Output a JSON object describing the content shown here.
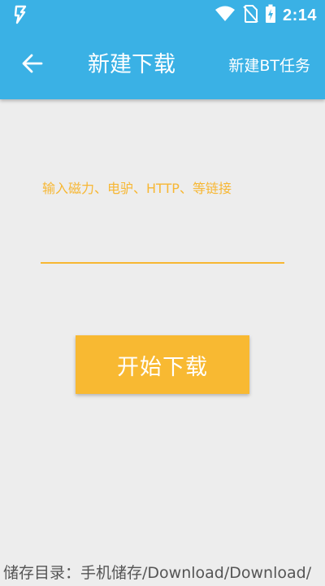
{
  "status_bar": {
    "time": "2:14",
    "icons": [
      "app-bolt-icon",
      "wifi-icon",
      "no-sim-icon",
      "battery-charging-icon"
    ]
  },
  "toolbar": {
    "back_icon": "back-arrow-icon",
    "title": "新建下载",
    "bt_task_label": "新建BT任务"
  },
  "form": {
    "link_label": "输入磁力、电驴、HTTP、等链接",
    "link_value": "",
    "start_button_label": "开始下载"
  },
  "footer": {
    "storage_dir": "储存目录：手机储存/Download/Download/"
  },
  "colors": {
    "accent_blue": "#3ab1e5",
    "accent_orange": "#f8b932",
    "background": "#ededed"
  }
}
